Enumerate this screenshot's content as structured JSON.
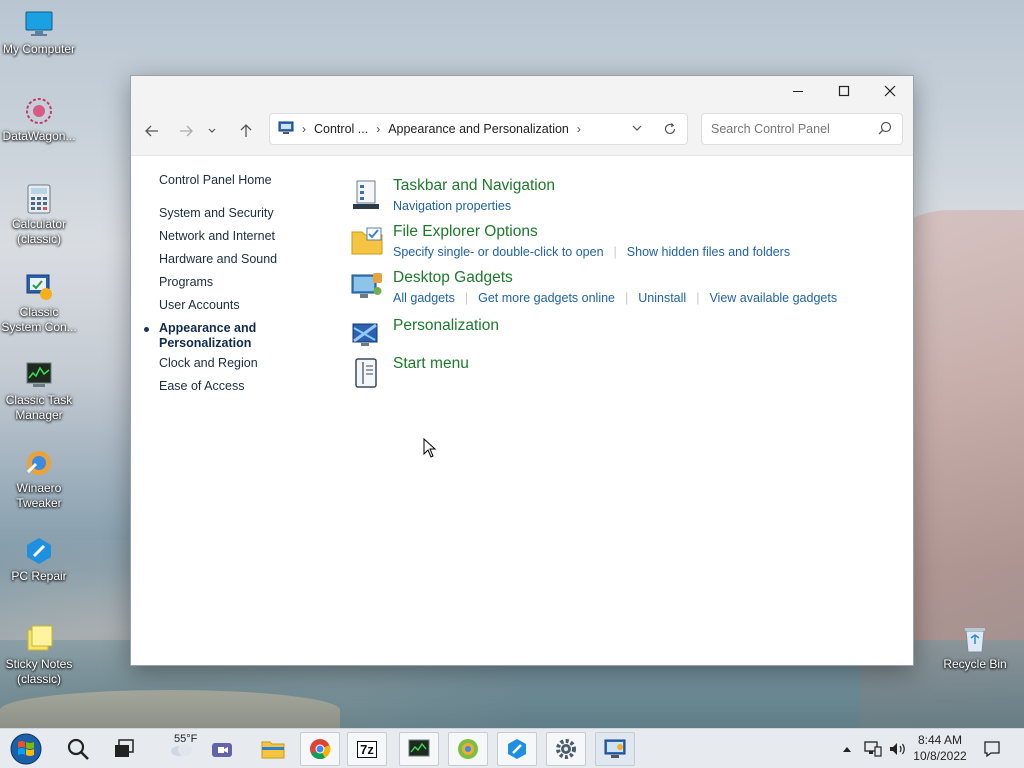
{
  "desktop": {
    "icons": [
      {
        "label": "My Computer",
        "icon": "monitor-icon"
      },
      {
        "label": "DataWagon...",
        "icon": "flower-icon"
      },
      {
        "label": "Calculator (classic)",
        "icon": "calculator-icon"
      },
      {
        "label": "Classic System Con...",
        "icon": "control-panel-icon"
      },
      {
        "label": "Classic Task Manager",
        "icon": "task-manager-icon"
      },
      {
        "label": "Winaero Tweaker",
        "icon": "tweaker-icon"
      },
      {
        "label": "PC Repair",
        "icon": "repair-icon"
      },
      {
        "label": "Sticky Notes (classic)",
        "icon": "sticky-notes-icon"
      },
      {
        "label": "Recycle Bin",
        "icon": "recycle-bin-icon"
      }
    ]
  },
  "window": {
    "address": {
      "seg1": "Control ...",
      "seg2": "Appearance and Personalization"
    },
    "search_placeholder": "Search Control Panel"
  },
  "left_nav": {
    "home": "Control Panel Home",
    "items": [
      "System and Security",
      "Network and Internet",
      "Hardware and Sound",
      "Programs",
      "User Accounts"
    ],
    "current": "Appearance and Personalization",
    "after": [
      "Clock and Region",
      "Ease of Access"
    ]
  },
  "categories": [
    {
      "title": "Taskbar and Navigation",
      "links": [
        "Navigation properties"
      ]
    },
    {
      "title": "File Explorer Options",
      "links": [
        "Specify single- or double-click to open",
        "Show hidden files and folders"
      ]
    },
    {
      "title": "Desktop Gadgets",
      "links": [
        "All gadgets",
        "Get more gadgets online",
        "Uninstall",
        "View available gadgets"
      ]
    },
    {
      "title": "Personalization",
      "links": []
    },
    {
      "title": "Start menu",
      "links": []
    }
  ],
  "taskbar": {
    "weather": "55°F",
    "time": "8:44 AM",
    "date": "10/8/2022",
    "sevenzip_label": "7z"
  },
  "colors": {
    "category_title": "#1c7a2a",
    "link": "#1f62a6"
  }
}
